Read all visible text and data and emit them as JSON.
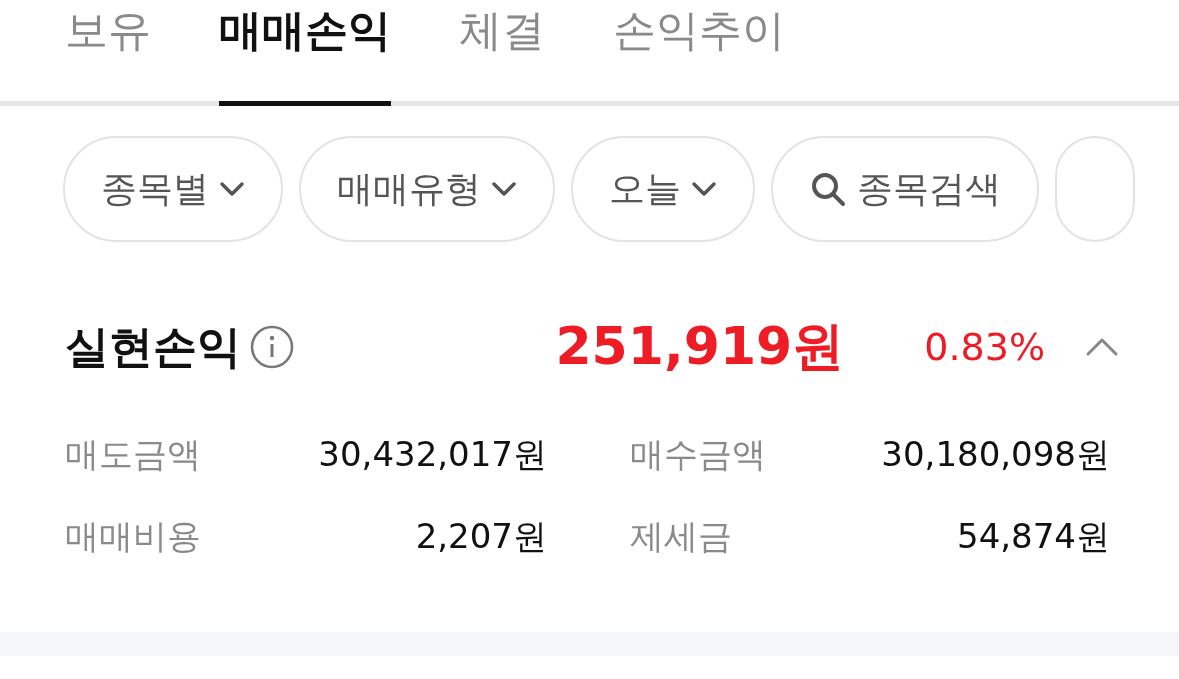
{
  "tabs": [
    {
      "label": "보유",
      "selected": false
    },
    {
      "label": "매매손익",
      "selected": true
    },
    {
      "label": "체결",
      "selected": false
    },
    {
      "label": "손익추이",
      "selected": false
    }
  ],
  "filters": [
    {
      "label": "종목별",
      "kind": "dropdown"
    },
    {
      "label": "매매유형",
      "kind": "dropdown"
    },
    {
      "label": "오늘",
      "kind": "dropdown"
    },
    {
      "label": "종목검색",
      "kind": "search"
    }
  ],
  "summary": {
    "title": "실현손익",
    "amount": "251,919원",
    "rate": "0.83%",
    "expanded": true
  },
  "details": [
    {
      "label": "매도금액",
      "value": "30,432,017원"
    },
    {
      "label": "매수금액",
      "value": "30,180,098원"
    },
    {
      "label": "매매비용",
      "value": "2,207원"
    },
    {
      "label": "제세금",
      "value": "54,874원"
    }
  ]
}
